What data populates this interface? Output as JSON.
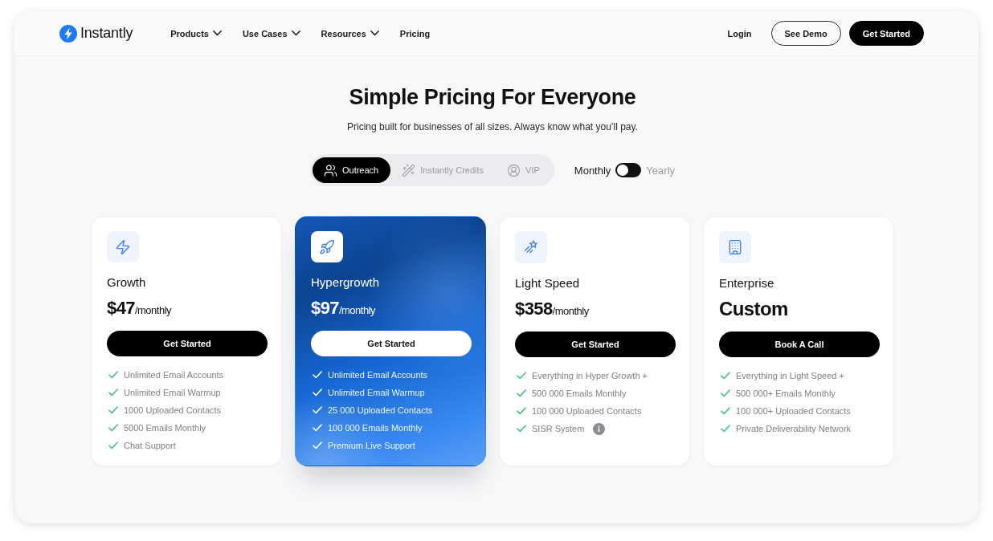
{
  "nav": {
    "brand": "Instantly",
    "links": [
      {
        "label": "Products",
        "has_menu": true
      },
      {
        "label": "Use Cases",
        "has_menu": true
      },
      {
        "label": "Resources",
        "has_menu": true
      },
      {
        "label": "Pricing",
        "has_menu": false
      }
    ],
    "login": "Login",
    "demo_button": "See Demo",
    "cta_button": "Get Started"
  },
  "hero": {
    "title": "Simple Pricing For Everyone",
    "subtitle": "Pricing built for businesses of all sizes. Always know what you’ll pay."
  },
  "plan_tabs": [
    {
      "label": "Outreach",
      "selected": true
    },
    {
      "label": "Instantly Credits",
      "selected": false
    },
    {
      "label": "VIP",
      "selected": false
    }
  ],
  "billing": {
    "monthly_label": "Monthly",
    "yearly_label": "Yearly",
    "yearly": false
  },
  "plans": [
    {
      "name": "Growth",
      "price": "$47",
      "period": "/monthly",
      "featured": false,
      "button": "Get Started",
      "features": [
        {
          "text": "Unlimited Email Accounts",
          "info": false
        },
        {
          "text": "Unlimited Email Warmup",
          "info": false
        },
        {
          "text": "1000 Uploaded Contacts",
          "info": false
        },
        {
          "text": "5000 Emails Monthly",
          "info": false
        },
        {
          "text": "Chat Support",
          "info": false
        }
      ]
    },
    {
      "name": "Hypergrowth",
      "price": "$97",
      "period": "/monthly",
      "featured": true,
      "button": "Get Started",
      "features": [
        {
          "text": "Unlimited Email Accounts",
          "info": false
        },
        {
          "text": "Unlimited Email Warmup",
          "info": false
        },
        {
          "text": "25 000 Uploaded Contacts",
          "info": false
        },
        {
          "text": "100 000 Emails Monthly",
          "info": false
        },
        {
          "text": "Premium Live Support",
          "info": false
        }
      ]
    },
    {
      "name": "Light Speed",
      "price": "$358",
      "period": "/monthly",
      "featured": false,
      "button": "Get Started",
      "features": [
        {
          "text": "Everything in Hyper Growth +",
          "info": false
        },
        {
          "text": "500 000 Emails Monthly",
          "info": false
        },
        {
          "text": "100 000 Uploaded Contacts",
          "info": false
        },
        {
          "text": "SISR System",
          "info": true
        }
      ]
    },
    {
      "name": "Enterprise",
      "price": "Custom",
      "featured": false,
      "button": "Book A Call",
      "features": [
        {
          "text": "Everything in Light Speed +",
          "info": false
        },
        {
          "text": "500 000+ Emails Monthly",
          "info": false
        },
        {
          "text": "100 000+ Uploaded Contacts",
          "info": false
        },
        {
          "text": "Private Deliverability Network",
          "info": false
        }
      ]
    }
  ]
}
